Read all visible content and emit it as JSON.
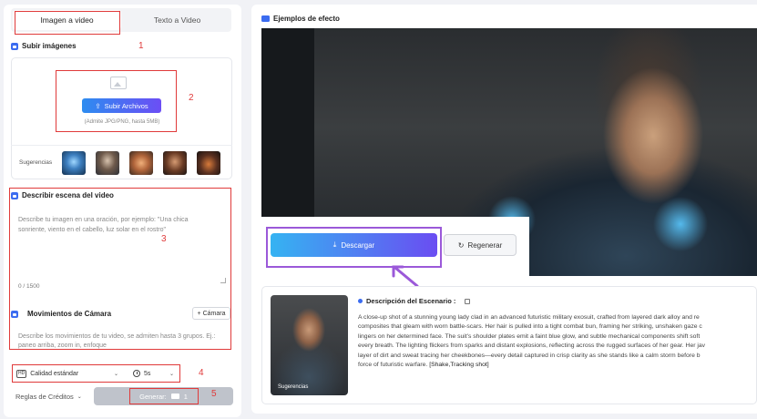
{
  "tabs": {
    "image_to_video": "Imagen a video",
    "text_to_video": "Texto a Video"
  },
  "upload": {
    "section_title": "Subir imágenes",
    "button_label": "Subir Archivos",
    "hint": "(Admite JPG/PNG, hasta 5MB)",
    "suggestions_label": "Sugerencias"
  },
  "scene": {
    "section_title": "Describir escena del video",
    "placeholder": "Describe tu imagen en una oración, por ejemplo: \"Una chica sonriente, viento en el cabello, luz solar en el rostro\"",
    "counter": "0 / 1500"
  },
  "camera": {
    "section_title": "Movimientos de Cámara",
    "add_button": "+ Cámara",
    "placeholder": "Describe los movimientos de tu video, se admiten hasta 3 grupos. Ej.: paneo arriba, zoom in, enfoque"
  },
  "settings": {
    "quality_icon": "HD",
    "quality": "Calidad estándar",
    "duration": "5s"
  },
  "footer": {
    "credits_rules": "Reglas de Créditos",
    "generate_label": "Generar:",
    "generate_cost": "1"
  },
  "annotations": {
    "n1": "1",
    "n2": "2",
    "n3": "3",
    "n4": "4",
    "n5": "5"
  },
  "examples": {
    "section_title": "Ejemplos de efecto",
    "download_label": "Descargar",
    "regenerate_label": "Regenerar",
    "suggestion_tag": "Sugerencias",
    "description_title": "Descripción del Escenario :",
    "description_text": "A close-up shot of a stunning young lady clad in an advanced futuristic military exosuit, crafted from layered dark alloy and re\ncomposites that gleam with worn battle-scars. Her hair is pulled into a tight combat bun, framing her striking, unshaken gaze c\nlingers on her determined face. The suit's shoulder plates emit a faint blue glow, and subtle mechanical components shift soft\nevery breath. The lighting flickers from sparks and distant explosions, reflecting across the rugged surfaces of her gear. Her jav\nlayer of dirt and sweat tracing her cheekbones—every detail captured in crisp clarity as she stands like a calm storm before b\nforce of futuristic warfare.",
    "description_tags": "[Shake,Tracking shot]"
  },
  "colors": {
    "accent": "#3b6cf0",
    "annotation_red": "#e03a3a",
    "annotation_purple": "#9b59d9"
  }
}
